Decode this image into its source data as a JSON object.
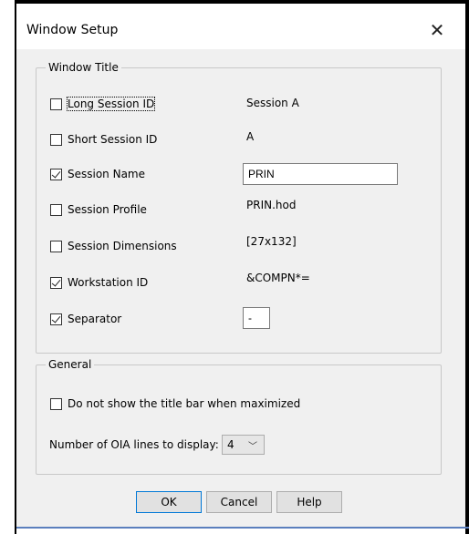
{
  "dialog": {
    "title": "Window Setup",
    "close_glyph": "✕"
  },
  "window_title_group": {
    "legend": "Window Title",
    "items": [
      {
        "label": "Long Session ID",
        "checked": false,
        "value": "Session A"
      },
      {
        "label": "Short Session ID",
        "checked": false,
        "value": "A"
      },
      {
        "label": "Session Name",
        "checked": true,
        "value": "PRIN"
      },
      {
        "label": "Session Profile",
        "checked": false,
        "value": "PRIN.hod"
      },
      {
        "label": "Session Dimensions",
        "checked": false,
        "value": "[27x132]"
      },
      {
        "label": "Workstation ID",
        "checked": true,
        "value": "&COMPN*="
      },
      {
        "label": "Separator",
        "checked": true,
        "value": "-"
      }
    ]
  },
  "general_group": {
    "legend": "General",
    "hide_title_bar_label": "Do not show the title bar when maximized",
    "hide_title_bar_checked": false,
    "oia_lines_label": "Number of OIA lines to display:",
    "oia_lines_value": "4"
  },
  "buttons": {
    "ok": "OK",
    "cancel": "Cancel",
    "help": "Help"
  }
}
